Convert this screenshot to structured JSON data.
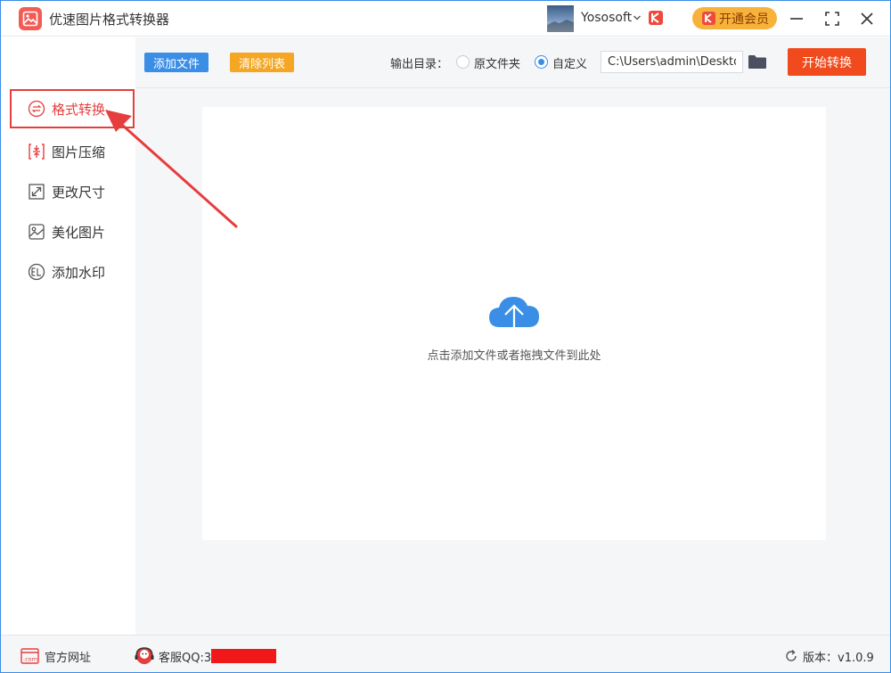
{
  "app": {
    "title": "优速图片格式转换器",
    "username": "Yososoft",
    "vip_label": "开通会员"
  },
  "sidebar": {
    "items": [
      {
        "label": "格式转换",
        "icon": "format-convert-icon",
        "active": true
      },
      {
        "label": "图片压缩",
        "icon": "compress-icon",
        "active": false
      },
      {
        "label": "更改尺寸",
        "icon": "resize-icon",
        "active": false
      },
      {
        "label": "美化图片",
        "icon": "beautify-icon",
        "active": false
      },
      {
        "label": "添加水印",
        "icon": "watermark-icon",
        "active": false
      }
    ]
  },
  "toolbar": {
    "add_label": "添加文件",
    "clear_label": "清除列表",
    "output_label": "输出目录：",
    "radio_original": "原文件夹",
    "radio_custom": "自定义",
    "selected_output": "custom",
    "path_value": "C:\\Users\\admin\\Deskto",
    "start_label": "开始转换"
  },
  "dropzone": {
    "hint": "点击添加文件或者拖拽文件到此处"
  },
  "statusbar": {
    "site_label": "官方网址",
    "qq_label": "客服QQ:3",
    "version_label": "版本：v1.0.9"
  },
  "colors": {
    "accent_blue": "#3a8ee6",
    "clear_orange": "#f5a623",
    "start_red": "#f04a1d",
    "active_red": "#e63d3d",
    "vip_gold": "#f7b23b"
  }
}
